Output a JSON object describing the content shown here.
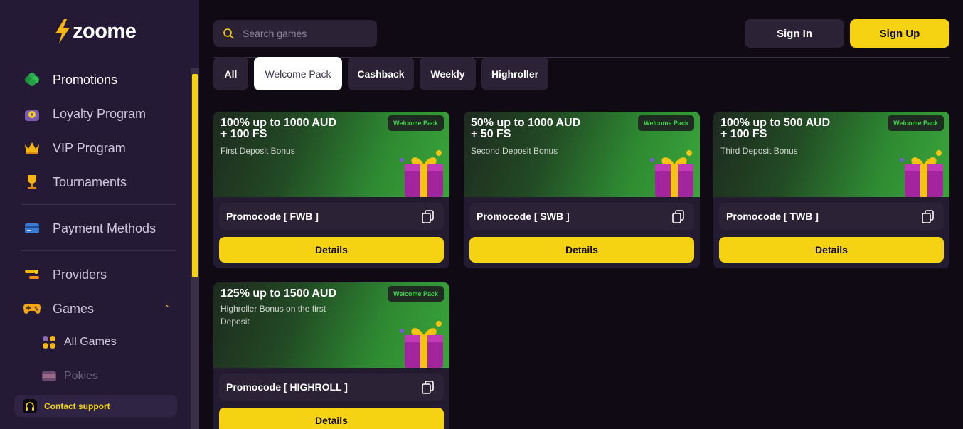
{
  "brand": {
    "name": "zoome"
  },
  "sidebar": {
    "items": [
      {
        "label": "Promotions",
        "icon": "clover-icon"
      },
      {
        "label": "Loyalty Program",
        "icon": "loyalty-chest-icon"
      },
      {
        "label": "VIP Program",
        "icon": "crown-icon"
      },
      {
        "label": "Tournaments",
        "icon": "trophy-icon"
      },
      {
        "label": "Payment Methods",
        "icon": "credit-card-icon"
      },
      {
        "label": "Providers",
        "icon": "providers-icon"
      },
      {
        "label": "Games",
        "icon": "gamepad-icon"
      }
    ],
    "sub_items": [
      {
        "label": "All Games",
        "icon": "grid-dots-icon"
      },
      {
        "label": "Pokies",
        "icon": "slot-machine-icon"
      }
    ],
    "contact": "Contact support"
  },
  "header": {
    "search_placeholder": "Search games",
    "sign_in": "Sign In",
    "sign_up": "Sign Up"
  },
  "tabs": [
    "All",
    "Welcome Pack",
    "Cashback",
    "Weekly",
    "Highroller"
  ],
  "active_tab": "Welcome Pack",
  "cards": [
    {
      "line1": "100% up to 1000 AUD",
      "line2": "+ 100 FS",
      "subtitle": "First Deposit Bonus",
      "badge": "Welcome Pack",
      "promo": "Promocode [ FWB ]",
      "details": "Details"
    },
    {
      "line1": "50% up to 1000 AUD",
      "line2": "+ 50 FS",
      "subtitle": "Second Deposit Bonus",
      "badge": "Welcome Pack",
      "promo": "Promocode [ SWB ]",
      "details": "Details"
    },
    {
      "line1": "100% up to 500 AUD",
      "line2": "+ 100 FS",
      "subtitle": "Third Deposit Bonus",
      "badge": "Welcome Pack",
      "promo": "Promocode [ TWB ]",
      "details": "Details"
    },
    {
      "line1": "125% up to 1500 AUD",
      "line2": "",
      "subtitle": "Highroller Bonus on the first Deposit",
      "badge": "Welcome Pack",
      "promo": "Promocode [ HIGHROLL ]",
      "details": "Details"
    }
  ],
  "colors": {
    "accent": "#f5d312",
    "sidebar_bg": "#251a36",
    "page_bg": "#0f0a14",
    "badge_text": "#3fd44a"
  }
}
